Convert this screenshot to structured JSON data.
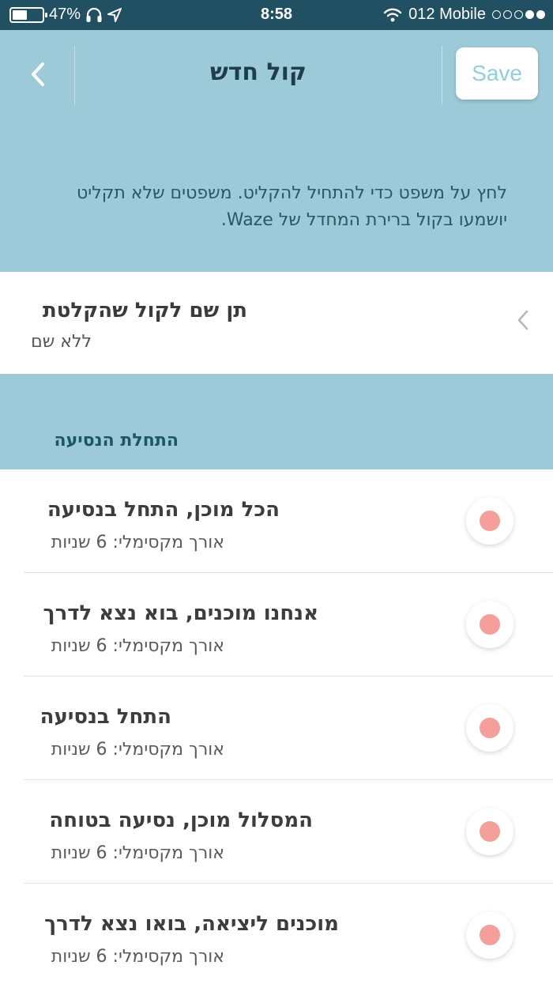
{
  "status_bar": {
    "battery": "47%",
    "time": "8:58",
    "carrier": "012 Mobile",
    "icons": [
      "battery-icon",
      "headphones-icon",
      "location-arrow-icon",
      "wifi-icon",
      "signal-dots-icon"
    ]
  },
  "nav": {
    "back_icon": "chevron-left-icon",
    "title": "קול חדש",
    "save_label": "Save"
  },
  "info_text": "לחץ על משפט כדי להתחיל להקליט. משפטים שלא תקליט יושמעו בקול ברירת המחדל של Waze.",
  "name_row": {
    "title": "תן שם לקול שהקלטת",
    "subtitle": "ללא שם"
  },
  "section": {
    "title": "התחלת הנסיעה"
  },
  "items": [
    {
      "title": "הכל מוכן, התחל בנסיעה",
      "subtitle": "אורך מקסימלי: 6 שניות"
    },
    {
      "title": "אנחנו מוכנים, בוא נצא לדרך",
      "subtitle": "אורך מקסימלי: 6 שניות"
    },
    {
      "title": "התחל בנסיעה",
      "subtitle": "אורך מקסימלי: 6 שניות"
    },
    {
      "title": "המסלול מוכן, נסיעה בטוחה",
      "subtitle": "אורך מקסימלי: 6 שניות"
    },
    {
      "title": "מוכנים ליציאה, בואו נצא לדרך",
      "subtitle": "אורך מקסימלי: 6 שניות"
    }
  ],
  "colors": {
    "status_bar": "#215063",
    "header_bg": "#9ccad8",
    "save_text": "#8fcfe0",
    "record_dot": "#f49f9a"
  }
}
